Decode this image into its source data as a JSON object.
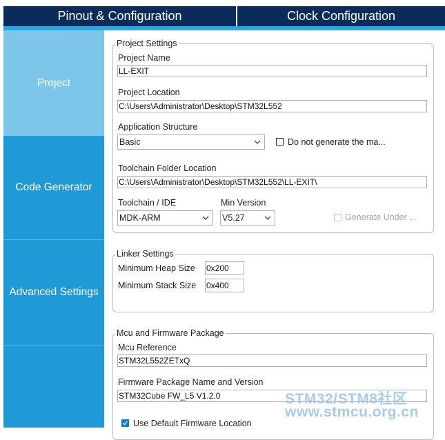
{
  "top_tabs": [
    "Pinout & Configuration",
    "Clock Configuration"
  ],
  "sidebar": {
    "items": [
      {
        "label": "Project",
        "active": true
      },
      {
        "label": "Code Generator",
        "active": false
      },
      {
        "label": "Advanced Settings",
        "active": false
      }
    ]
  },
  "project_settings": {
    "legend": "Project Settings",
    "project_name_label": "Project Name",
    "project_name": "LL-EXIT",
    "project_location_label": "Project Location",
    "project_location": "C:\\Users\\Administrator\\Desktop\\STM32L552",
    "app_structure_label": "Application Structure",
    "app_structure": "Basic",
    "do_not_generate_label": "Do not generate the ma...",
    "do_not_generate_checked": false,
    "toolchain_folder_label": "Toolchain Folder Location",
    "toolchain_folder": "C:\\Users\\Administrator\\Desktop\\STM32L552\\LL-EXIT\\",
    "toolchain_ide_label": "Toolchain / IDE",
    "toolchain_ide": "MDK-ARM",
    "min_version_label": "Min Version",
    "min_version": "V5.27",
    "generate_under_label": "Generate Under ...",
    "generate_under_checked": false
  },
  "linker_settings": {
    "legend": "Linker Settings",
    "heap_label": "Minimum Heap Size",
    "heap_value": "0x200",
    "stack_label": "Minimum Stack Size",
    "stack_value": "0x400"
  },
  "mcu_firmware": {
    "legend": "Mcu and Firmware Package",
    "mcu_reference_label": "Mcu Reference",
    "mcu_reference": "STM32L552ZETxQ",
    "firmware_label": "Firmware Package Name and Version",
    "firmware_value": "STM32Cube FW_L5 V1.2.0",
    "use_default_label": "Use Default Firmware Location",
    "use_default_checked": true
  },
  "watermark": {
    "line1": "STM32/STM8社区",
    "line2": "www.stmcu.org.cn"
  },
  "colors": {
    "topbar": "#0b2c5a",
    "accent": "#2aa9e0",
    "sidebar": "#1f9ad6",
    "sidebar_active": "#7cc6ea"
  }
}
